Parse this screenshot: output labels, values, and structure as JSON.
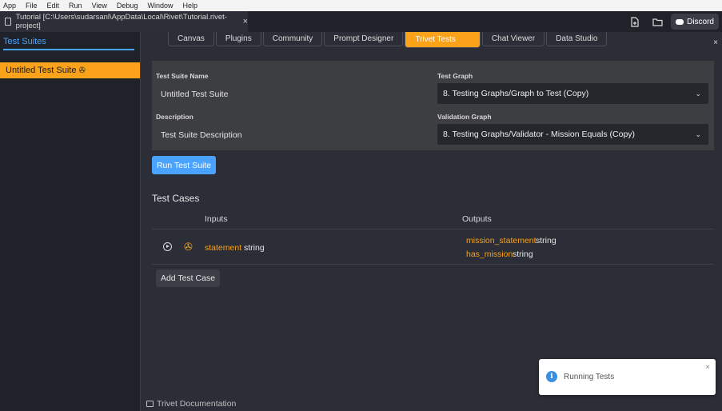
{
  "menu": [
    "App",
    "File",
    "Edit",
    "Run",
    "View",
    "Debug",
    "Window",
    "Help"
  ],
  "project_tab": {
    "title": "Tutorial [C:\\Users\\sudarsanl\\AppData\\Local\\Rivet\\Tutorial.rivet-project]",
    "close": "×"
  },
  "titlebar": {
    "discord_label": "Discord",
    "new_file_icon": "new-file-icon",
    "folder_icon": "folder-icon"
  },
  "sidebar": {
    "header": "Test Suites",
    "suites": [
      {
        "label": "Untitled Test Suite",
        "icon": "pin-icon"
      }
    ]
  },
  "tabs": [
    {
      "label": "Canvas",
      "active": false
    },
    {
      "label": "Plugins",
      "active": false
    },
    {
      "label": "Community",
      "active": false
    },
    {
      "label": "Prompt Designer",
      "active": false
    },
    {
      "label": "Trivet Tests",
      "active": true
    },
    {
      "label": "Chat Viewer",
      "active": false
    },
    {
      "label": "Data Studio",
      "active": false
    }
  ],
  "panel_close": "×",
  "form": {
    "suite_name_label": "Test Suite Name",
    "suite_name_value": "Untitled Test Suite",
    "description_label": "Description",
    "description_value": "Test Suite Description",
    "test_graph_label": "Test Graph",
    "test_graph_value": "8. Testing Graphs/Graph to Test (Copy)",
    "validation_graph_label": "Validation Graph",
    "validation_graph_value": "8. Testing Graphs/Validator - Mission Equals (Copy)"
  },
  "run_button": "Run Test Suite",
  "test_cases": {
    "title": "Test Cases",
    "inputs_header": "Inputs",
    "outputs_header": "Outputs",
    "rows": [
      {
        "inputs": [
          {
            "name": "statement",
            "type": "string"
          }
        ],
        "outputs": [
          {
            "name": "mission_statement",
            "type": "string"
          },
          {
            "name": "has_mission",
            "type": "string"
          }
        ]
      }
    ],
    "add_button": "Add Test Case"
  },
  "footer": {
    "docs_link": "Trivet Documentation"
  },
  "toast": {
    "message": "Running Tests",
    "close": "×",
    "icon": "info-icon"
  },
  "colors": {
    "accent": "#f9a21a",
    "primary": "#4aa3ff",
    "background": "#2b2e36",
    "sidebar": "#1f2228"
  }
}
